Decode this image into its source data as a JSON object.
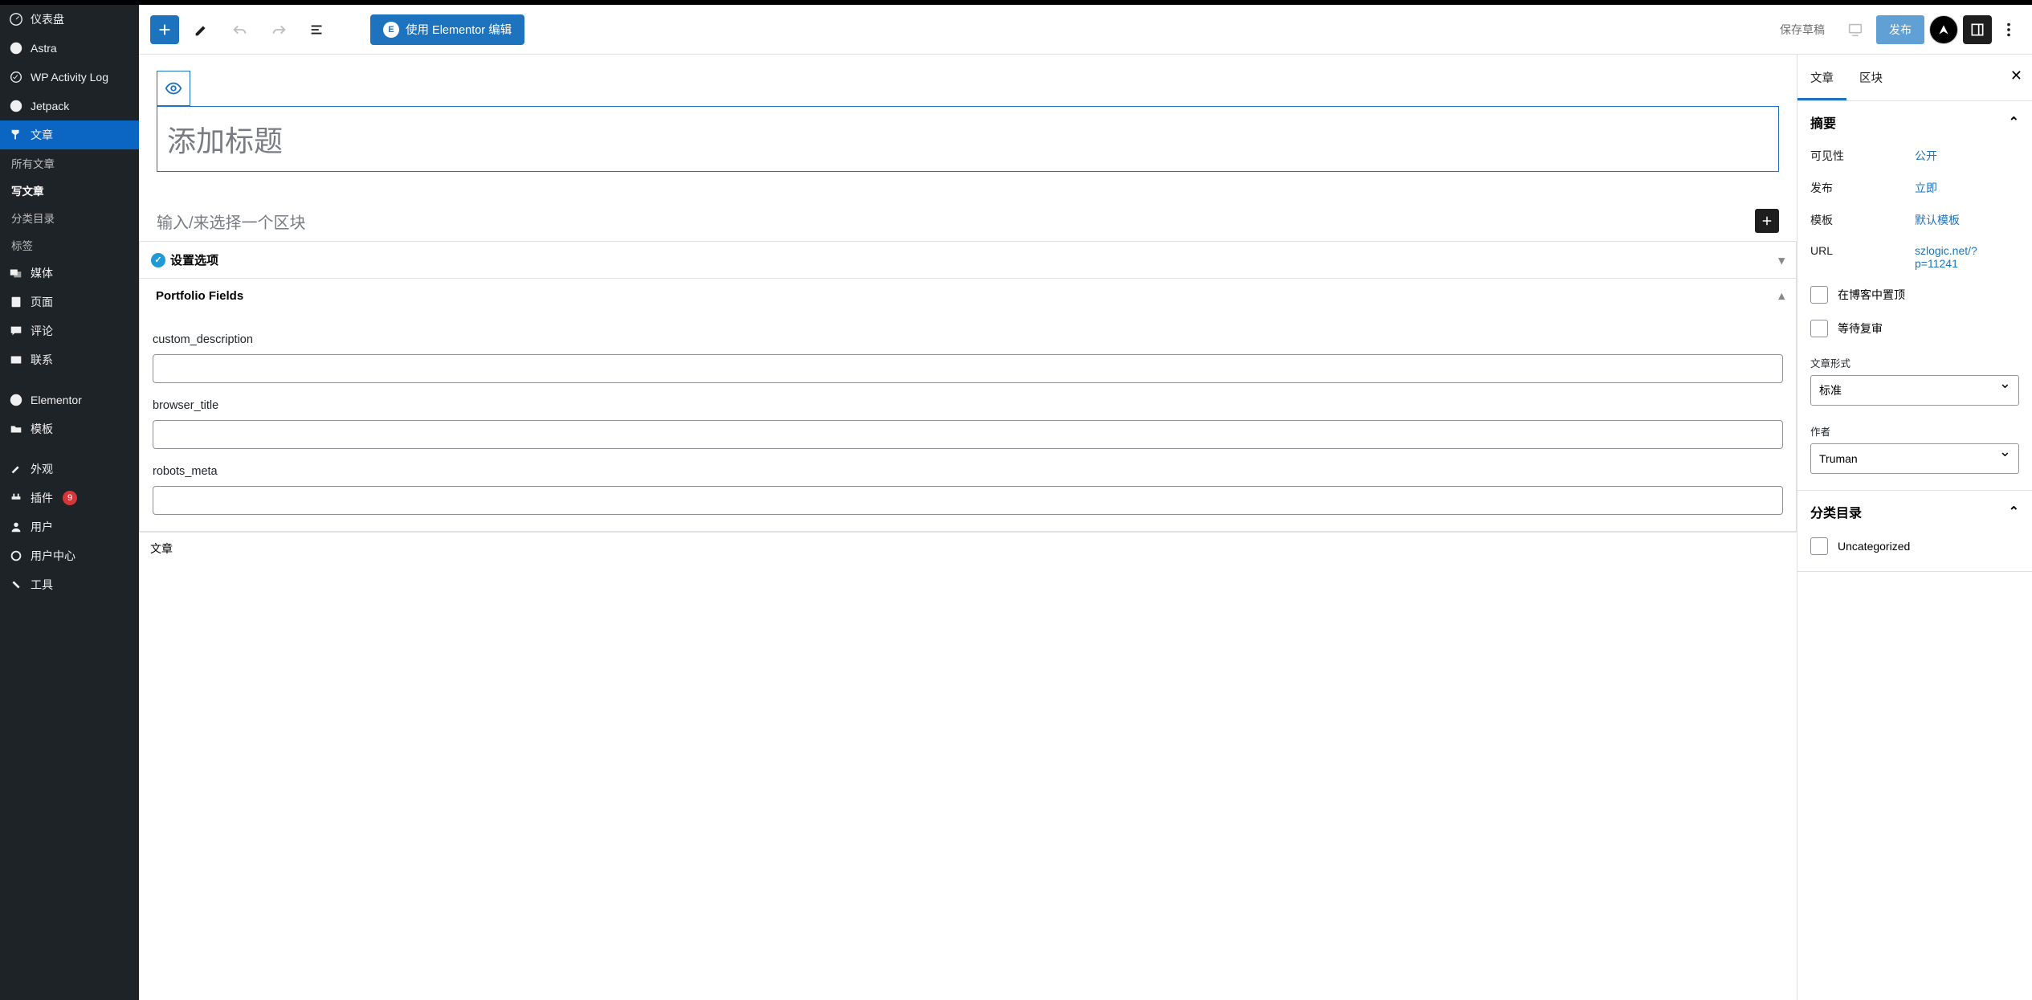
{
  "sidebar": {
    "items": [
      {
        "label": "仪表盘"
      },
      {
        "label": "Astra"
      },
      {
        "label": "WP Activity Log"
      },
      {
        "label": "Jetpack"
      },
      {
        "label": "文章"
      },
      {
        "label": "媒体"
      },
      {
        "label": "页面"
      },
      {
        "label": "评论"
      },
      {
        "label": "联系"
      },
      {
        "label": "Elementor"
      },
      {
        "label": "模板"
      },
      {
        "label": "外观"
      },
      {
        "label": "插件",
        "badge": "9"
      },
      {
        "label": "用户"
      },
      {
        "label": "用户中心"
      },
      {
        "label": "工具"
      }
    ],
    "subitems": [
      {
        "label": "所有文章"
      },
      {
        "label": "写文章"
      },
      {
        "label": "分类目录"
      },
      {
        "label": "标签"
      }
    ]
  },
  "toolbar": {
    "elementor_label": "使用 Elementor 编辑",
    "save_draft": "保存草稿",
    "publish": "发布"
  },
  "editor": {
    "title_placeholder": "添加标题",
    "block_placeholder": "输入/来选择一个区块",
    "settings_panel": "设置选项",
    "portfolio_panel": "Portfolio Fields",
    "fields": [
      {
        "label": "custom_description"
      },
      {
        "label": "browser_title"
      },
      {
        "label": "robots_meta"
      }
    ],
    "bottom_tab": "文章"
  },
  "settings": {
    "tabs": {
      "post": "文章",
      "block": "区块"
    },
    "summary_heading": "摘要",
    "rows": [
      {
        "lbl": "可见性",
        "val": "公开"
      },
      {
        "lbl": "发布",
        "val": "立即"
      },
      {
        "lbl": "模板",
        "val": "默认模板"
      },
      {
        "lbl": "URL",
        "val": "szlogic.net/?p=11241"
      }
    ],
    "check1": "在博客中置顶",
    "check2": "等待复审",
    "format_label": "文章形式",
    "format_value": "标准",
    "author_label": "作者",
    "author_value": "Truman",
    "category_heading": "分类目录",
    "category1": "Uncategorized"
  }
}
